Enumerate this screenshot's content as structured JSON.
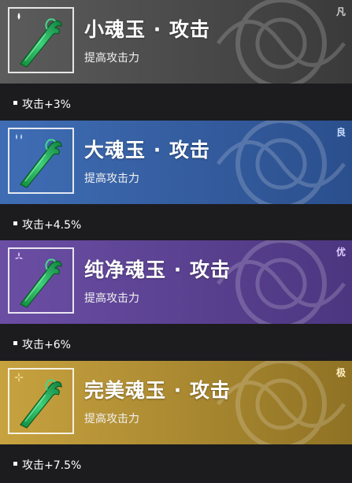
{
  "items": [
    {
      "title": "小魂玉 · 攻击",
      "subtitle": "提高攻击力",
      "tier": "凡",
      "stat": "攻击+3%",
      "colors": {
        "bg_from": "#5c5c5c",
        "bg_to": "#3a3a3a",
        "tier": "#cfcfcf",
        "icon": "#ffffff"
      },
      "rarity_icon": "drop-icon"
    },
    {
      "title": "大魂玉 · 攻击",
      "subtitle": "提高攻击力",
      "tier": "良",
      "stat": "攻击+4.5%",
      "colors": {
        "bg_from": "#3f6db4",
        "bg_to": "#2b4f8d",
        "tier": "#c8dcff",
        "icon": "#bcd8ff"
      },
      "rarity_icon": "double-drop-icon"
    },
    {
      "title": "纯净魂玉 · 攻击",
      "subtitle": "提高攻击力",
      "tier": "优",
      "stat": "攻击+6%",
      "colors": {
        "bg_from": "#6b4ea4",
        "bg_to": "#4c3680",
        "tier": "#e2ccff",
        "icon": "#e4cbff"
      },
      "rarity_icon": "triple-drop-icon"
    },
    {
      "title": "完美魂玉 · 攻击",
      "subtitle": "提高攻击力",
      "tier": "极",
      "stat": "攻击+7.5%",
      "colors": {
        "bg_from": "#c7a23f",
        "bg_to": "#8f7224",
        "tier": "#fff0c2",
        "icon": "#ffe9a8"
      },
      "rarity_icon": "quad-drop-icon"
    }
  ]
}
